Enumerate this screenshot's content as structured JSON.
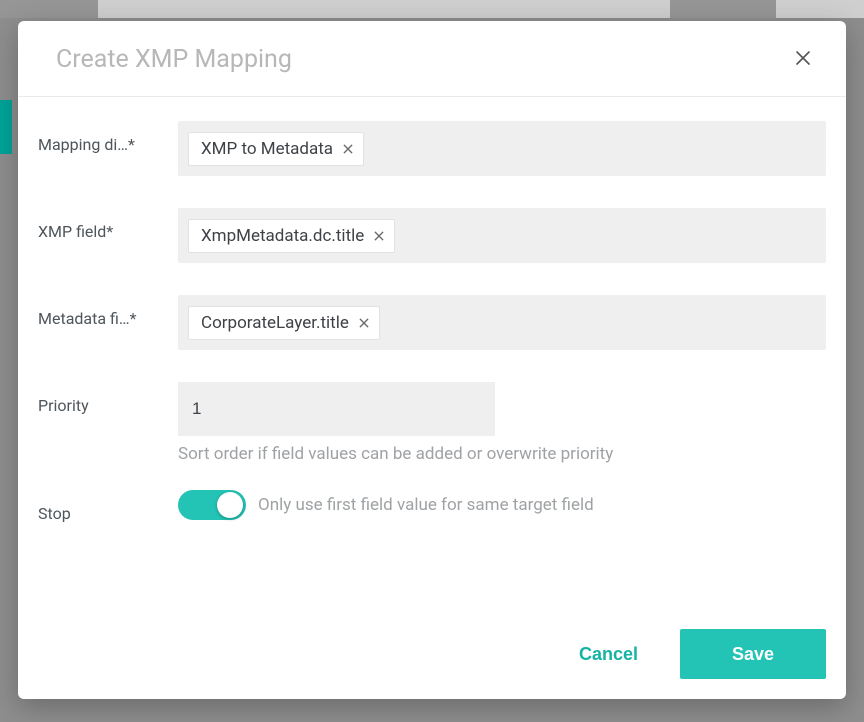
{
  "dialog": {
    "title": "Create XMP Mapping",
    "fields": {
      "mapping_direction": {
        "label": "Mapping di…",
        "value": "XMP to Metadata"
      },
      "xmp_field": {
        "label": "XMP field",
        "value": "XmpMetadata.dc.title"
      },
      "metadata_field": {
        "label": "Metadata fi…",
        "value": "CorporateLayer.title"
      },
      "priority": {
        "label": "Priority",
        "value": "1",
        "helper": "Sort order if field values can be added or overwrite priority"
      },
      "stop": {
        "label": "Stop",
        "enabled": true,
        "description": "Only use first field value for same target field"
      }
    },
    "actions": {
      "cancel": "Cancel",
      "save": "Save"
    }
  }
}
